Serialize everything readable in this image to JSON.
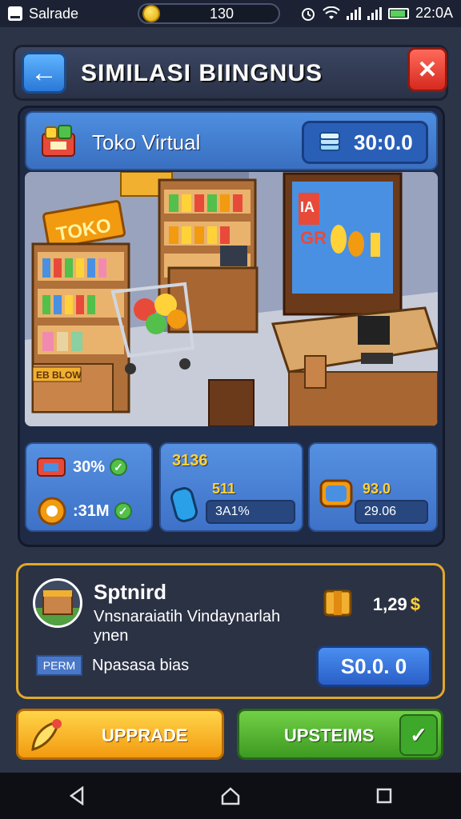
{
  "status_bar": {
    "app_name": "Salrade",
    "coins": "130",
    "time": "22:0A"
  },
  "header": {
    "title": "SIMILASI BIINGNUS"
  },
  "shop": {
    "name": "Toko Virtual",
    "money": "30:0.0",
    "sign_text": "TOKO",
    "sign_small": "EB BLOW",
    "screen_text_1": "IA",
    "screen_text_2": "GR"
  },
  "stats": {
    "card1": {
      "row1_value": "30%",
      "row2_value": ":31M"
    },
    "card2": {
      "title": "3136",
      "value1": "511",
      "value2": "3A1%"
    },
    "card3": {
      "value1": "93.0",
      "value2": "29.06"
    }
  },
  "product": {
    "name": "Sptnird",
    "description": "Vnsnaraiatih Vindaynarlah ynen",
    "price": "1,29",
    "tag": "PERM",
    "subtitle": "Npasasa bias",
    "buy_label": "S0.0. 0"
  },
  "actions": {
    "upgrade_label": "UPPRADE",
    "upstream_label": "UPSTEIMS"
  },
  "colors": {
    "accent_blue": "#4d8ee0",
    "accent_gold": "#e0a92a",
    "green": "#52c04a",
    "orange": "#f29a10"
  }
}
